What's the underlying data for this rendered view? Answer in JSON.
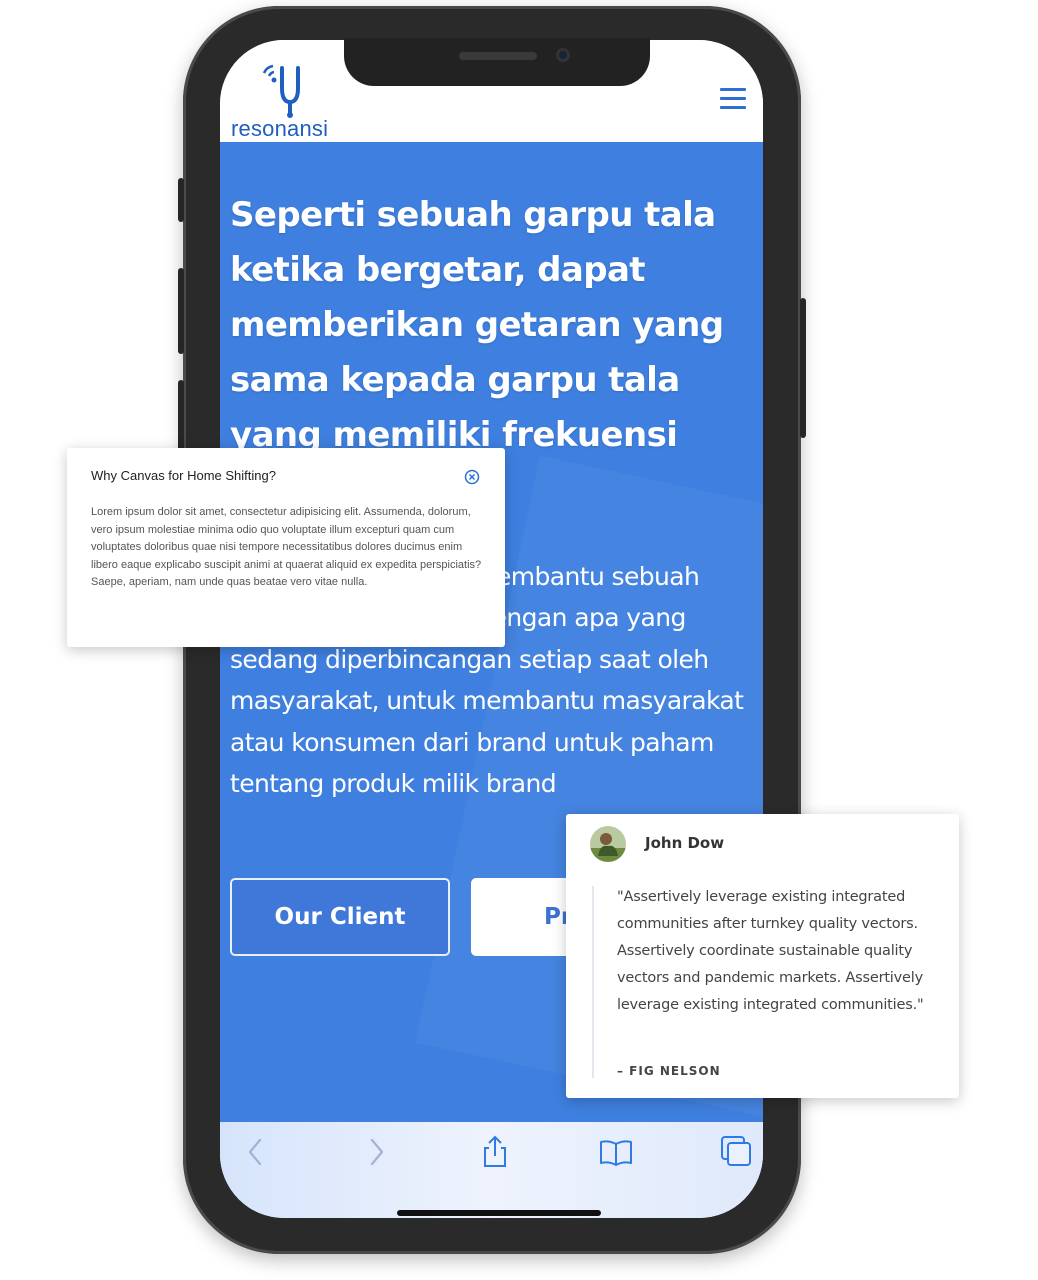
{
  "site": {
    "logo_text": "resonansi"
  },
  "hero": {
    "title": "Seperti sebuah garpu tala ketika bergetar, dapat memberikan getaran yang sama kepada garpu tala yang memiliki frekuensi yang",
    "body": "embantu sebuah ekuensi yang sama, dengan apa yang sedang diperbincangan setiap saat oleh masyarakat, untuk membantu masyarakat atau konsumen dari brand untuk paham tentang produk milik brand",
    "primary_button": "Our Client",
    "secondary_button": "Pr"
  },
  "popup": {
    "title": "Why Canvas for Home Shifting?",
    "body": "Lorem ipsum dolor sit amet, consectetur adipisicing elit. Assumenda, dolorum, vero ipsum molestiae minima odio quo voluptate illum excepturi quam cum voluptates doloribus quae nisi tempore necessitatibus dolores ducimus enim libero eaque explicabo suscipit animi at quaerat aliquid ex expedita perspiciatis? Saepe, aperiam, nam unde quas beatae vero vitae nulla."
  },
  "testimonial": {
    "name": "John Dow",
    "quote": "\"Assertively leverage existing integrated communities after turnkey quality vectors. Assertively coordinate sustainable quality vectors and pandemic markets. Assertively leverage existing integrated communities.\"",
    "author": "– FIG NELSON"
  },
  "toolbar": {
    "icons": [
      "back-icon",
      "forward-icon",
      "share-icon",
      "bookmarks-icon",
      "tabs-icon"
    ]
  },
  "colors": {
    "hero_blue": "#3e7fdf",
    "brand_blue": "#1f5fbf",
    "accent_blue": "#2e6fd3"
  }
}
